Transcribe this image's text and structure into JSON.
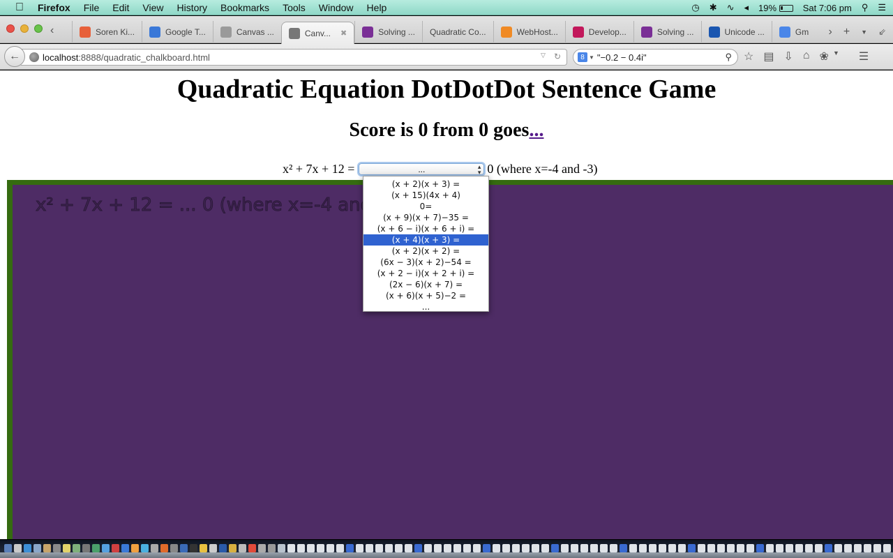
{
  "menubar": {
    "app": "Firefox",
    "items": [
      "File",
      "Edit",
      "View",
      "History",
      "Bookmarks",
      "Tools",
      "Window",
      "Help"
    ],
    "battery": "19%",
    "clock": "Sat 7:06 pm"
  },
  "tabs": [
    {
      "label": "Soren Ki...",
      "icon": "pinwheel-icon",
      "color": "#e7603a"
    },
    {
      "label": "Google T...",
      "icon": "google-translate-icon",
      "color": "#3a78d8"
    },
    {
      "label": "Canvas ...",
      "icon": "canvas-image-icon",
      "color": "#9a9a9a"
    },
    {
      "label": "Canv...",
      "icon": "globe-icon",
      "color": "#777777",
      "active": true
    },
    {
      "label": "Solving ...",
      "icon": "math-icon",
      "color": "#7a2f96"
    },
    {
      "label": "Quadratic Co...",
      "icon": "",
      "color": ""
    },
    {
      "label": "WebHost...",
      "icon": "cpanel-icon",
      "color": "#f08a24"
    },
    {
      "label": "Develop...",
      "icon": "n-logo-icon",
      "color": "#c2185b"
    },
    {
      "label": "Solving ...",
      "icon": "math-icon",
      "color": "#7a2f96"
    },
    {
      "label": "Unicode ...",
      "icon": "info-icon",
      "color": "#1a56b0"
    },
    {
      "label": "Gm",
      "icon": "google-icon",
      "color": "#4a86e8"
    }
  ],
  "navbar": {
    "url_host": "localhost",
    "url_rest": ":8888/quadratic_chalkboard.html",
    "search_value": "\"−0.2 − 0.4i\""
  },
  "page": {
    "title": "Quadratic Equation DotDotDot Sentence Game",
    "score_text": "Score is 0 from 0 goes",
    "score_link": "...",
    "equation_left": "x² + 7x + 12 =",
    "select_value": "...",
    "equation_right": "0 (where x=-4 and -3)",
    "chalk_text": "x² + 7x + 12 = ... 0 (where x=-4 and -3)"
  },
  "dropdown": {
    "options": [
      "(x + 2)(x + 3) =",
      "(x + 15)(4x + 4)",
      "0=",
      "(x + 9)(x + 7)−35 =",
      "(x + 6 − i)(x + 6 + i) =",
      "(x + 4)(x + 3) =",
      "(x + 2)(x + 2) =",
      "(6x − 3)(x + 2)−54 =",
      "(x + 2 − i)(x + 2 + i) =",
      "(2x − 6)(x + 7) =",
      "(x + 6)(x + 5)−2 =",
      "..."
    ],
    "highlighted_index": 5
  },
  "colors": {
    "chalkboard": "#4e2c65",
    "chalkboard_border": "#356b10",
    "highlight": "#2f62d0",
    "link": "#551a8b"
  }
}
